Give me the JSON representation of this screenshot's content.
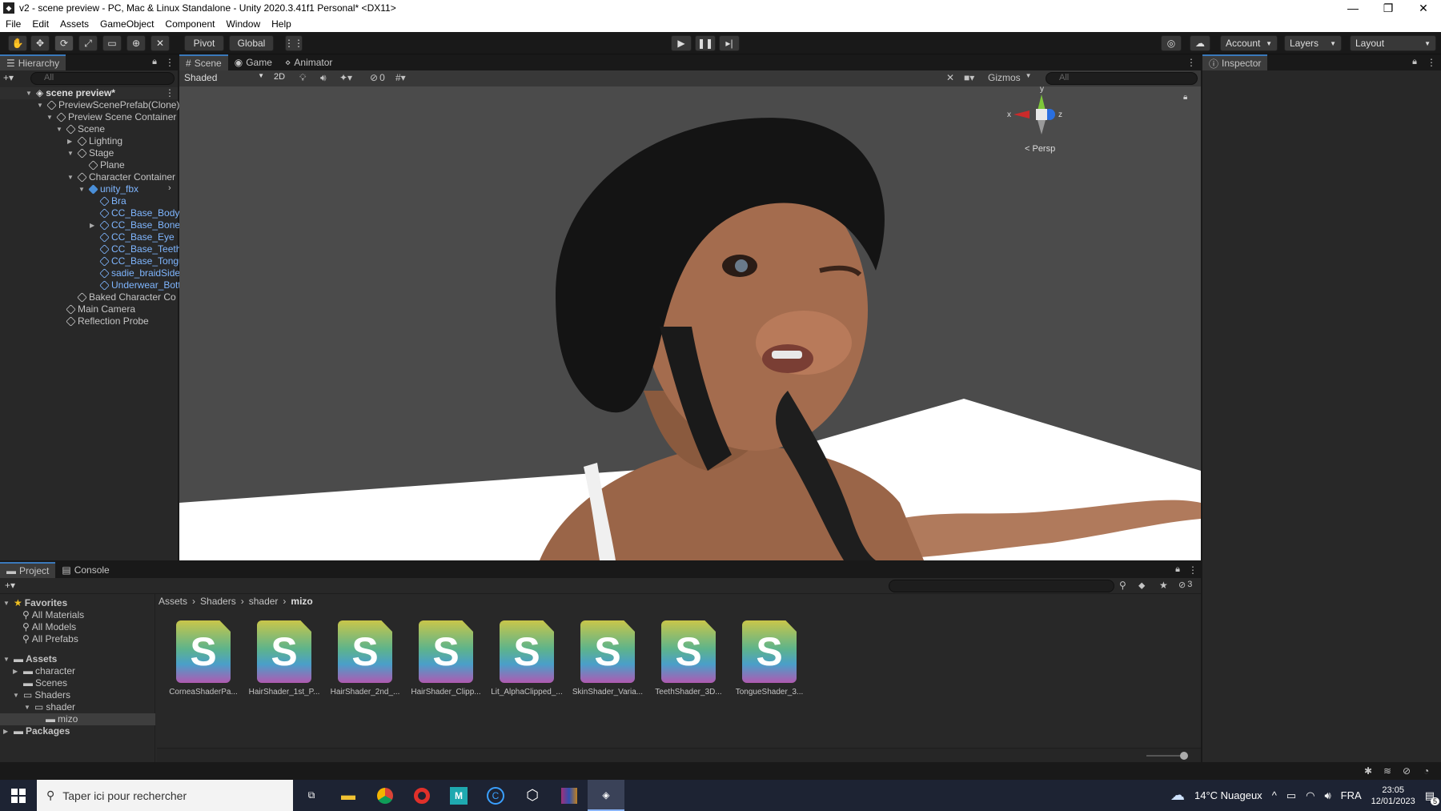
{
  "window": {
    "title": "v2 - scene preview - PC, Mac & Linux Standalone - Unity 2020.3.41f1 Personal* <DX11>",
    "buttons": [
      "—",
      "❐",
      "✕"
    ]
  },
  "menu": [
    "File",
    "Edit",
    "Assets",
    "GameObject",
    "Component",
    "Window",
    "Help"
  ],
  "toolbar": {
    "pivot": "Pivot",
    "global": "Global",
    "account": "Account",
    "layers": "Layers",
    "layout": "Layout"
  },
  "hierarchy": {
    "tab": "Hierarchy",
    "search_placeholder": "All",
    "scene_name": "scene preview*",
    "items": [
      {
        "label": "PreviewScenePrefab(Clone)",
        "depth": 1
      },
      {
        "label": "Preview Scene Container",
        "depth": 2
      },
      {
        "label": "Scene",
        "depth": 3
      },
      {
        "label": "Lighting",
        "depth": 4
      },
      {
        "label": "Stage",
        "depth": 4
      },
      {
        "label": "Plane",
        "depth": 5
      },
      {
        "label": "Character Container",
        "depth": 4
      },
      {
        "label": "unity_fbx",
        "depth": 5
      },
      {
        "label": "Bra",
        "depth": 6
      },
      {
        "label": "CC_Base_Body",
        "depth": 6
      },
      {
        "label": "CC_Base_BoneI",
        "depth": 6
      },
      {
        "label": "CC_Base_Eye",
        "depth": 6
      },
      {
        "label": "CC_Base_Teeth",
        "depth": 6
      },
      {
        "label": "CC_Base_Tongu",
        "depth": 6
      },
      {
        "label": "sadie_braidSide",
        "depth": 6
      },
      {
        "label": "Underwear_Bott",
        "depth": 6
      },
      {
        "label": "Baked Character Co",
        "depth": 4
      },
      {
        "label": "Main Camera",
        "depth": 3
      },
      {
        "label": "Reflection Probe",
        "depth": 3
      }
    ]
  },
  "scene_tabs": [
    "Scene",
    "Game",
    "Animator"
  ],
  "scene_toolbar": {
    "shading": "Shaded",
    "mode2d": "2D",
    "hidden_count": "0",
    "gizmos": "Gizmos",
    "search_placeholder": "All"
  },
  "gizmo": {
    "x": "x",
    "y": "y",
    "z": "z",
    "persp": "< Persp"
  },
  "inspector": {
    "tab": "Inspector"
  },
  "project": {
    "tabs": [
      "Project",
      "Console"
    ],
    "hidden_count": "3",
    "favorites": "Favorites",
    "fav_items": [
      "All Materials",
      "All Models",
      "All Prefabs"
    ],
    "assets": "Assets",
    "asset_folders": [
      "character",
      "Scenes",
      "Shaders",
      "shader",
      "mizo"
    ],
    "packages": "Packages",
    "breadcrumb": [
      "Assets",
      "Shaders",
      "shader",
      "mizo"
    ],
    "files": [
      "CorneaShaderPa...",
      "HairShader_1st_P...",
      "HairShader_2nd_...",
      "HairShader_Clipp...",
      "Lit_AlphaClipped_...",
      "SkinShader_Varia...",
      "TeethShader_3D...",
      "TongueShader_3..."
    ],
    "file_glyph": "S"
  },
  "taskbar": {
    "search_placeholder": "Taper ici pour rechercher",
    "weather": "14°C  Nuageux",
    "lang": "FRA",
    "time": "23:05",
    "date": "12/01/2023",
    "notifications": "5"
  }
}
